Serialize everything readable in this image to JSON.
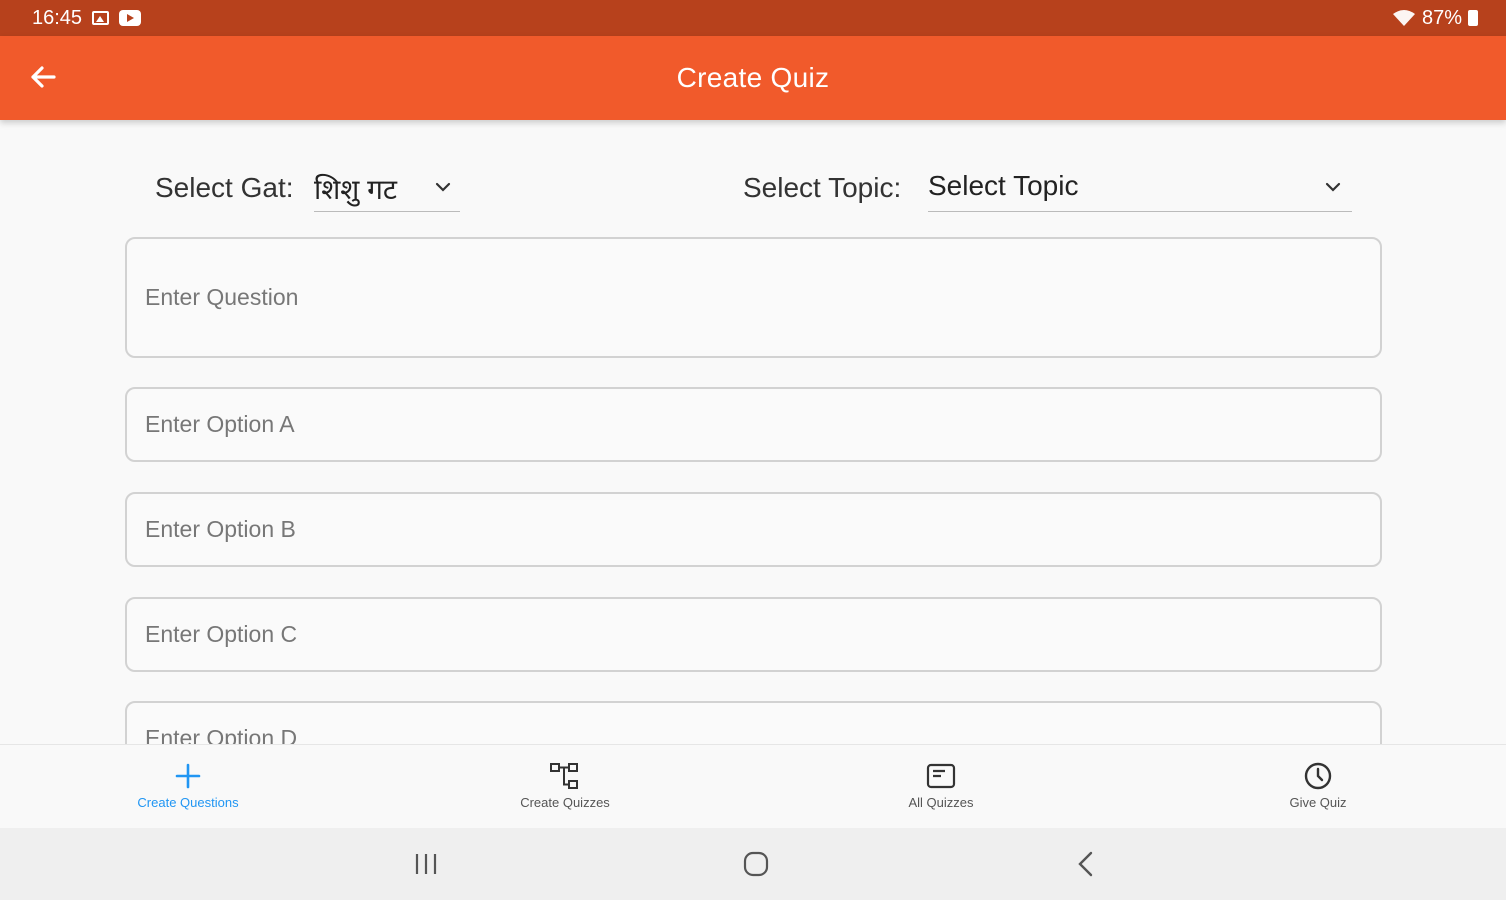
{
  "status_bar": {
    "time": "16:45",
    "battery": "87%"
  },
  "app_bar": {
    "title": "Create Quiz"
  },
  "selectors": {
    "gat_label": "Select Gat:",
    "gat_value": "शिशु गट",
    "topic_label": "Select Topic:",
    "topic_value": "Select Topic"
  },
  "form": {
    "question_placeholder": "Enter Question",
    "option_a_placeholder": "Enter Option A",
    "option_b_placeholder": "Enter Option B",
    "option_c_placeholder": "Enter Option C",
    "option_d_placeholder": "Enter Option D"
  },
  "bottom_nav": {
    "items": [
      {
        "label": "Create Questions",
        "icon": "plus-icon",
        "active": true
      },
      {
        "label": "Create Quizzes",
        "icon": "hierarchy-icon",
        "active": false
      },
      {
        "label": "All Quizzes",
        "icon": "list-card-icon",
        "active": false
      },
      {
        "label": "Give Quiz",
        "icon": "clock-icon",
        "active": false
      }
    ]
  },
  "colors": {
    "status_bar": "#b7411c",
    "app_bar": "#f15a2b",
    "active_nav": "#2196f3"
  }
}
